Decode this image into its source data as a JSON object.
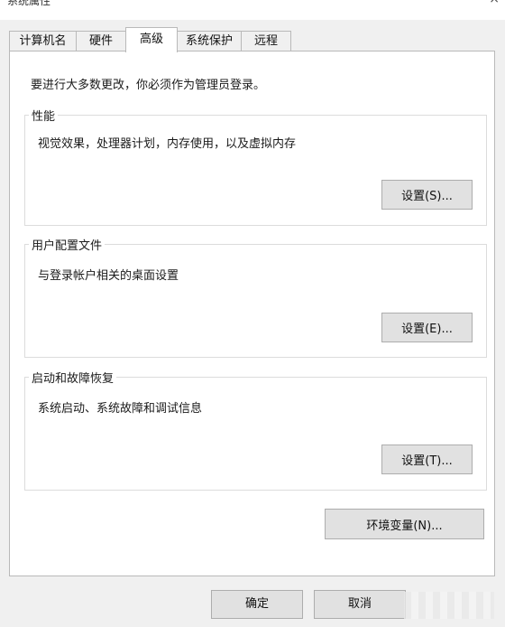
{
  "window": {
    "title": "系统属性",
    "close_glyph": "×"
  },
  "tabs": [
    {
      "label": "计算机名",
      "active": false
    },
    {
      "label": "硬件",
      "active": false
    },
    {
      "label": "高级",
      "active": true
    },
    {
      "label": "系统保护",
      "active": false
    },
    {
      "label": "远程",
      "active": false
    }
  ],
  "advanced": {
    "admin_note": "要进行大多数更改，你必须作为管理员登录。",
    "performance": {
      "title": "性能",
      "description": "视觉效果，处理器计划，内存使用，以及虚拟内存",
      "button": "设置(S)..."
    },
    "user_profiles": {
      "title": "用户配置文件",
      "description": "与登录帐户相关的桌面设置",
      "button": "设置(E)..."
    },
    "startup_recovery": {
      "title": "启动和故障恢复",
      "description": "系统启动、系统故障和调试信息",
      "button": "设置(T)..."
    },
    "env_button": "环境变量(N)..."
  },
  "footer": {
    "ok": "确定",
    "cancel": "取消"
  },
  "colors": {
    "dialog_bg": "#f0f0f0",
    "panel_bg": "#ffffff",
    "button_bg": "#e1e1e1",
    "border": "#adadad"
  }
}
